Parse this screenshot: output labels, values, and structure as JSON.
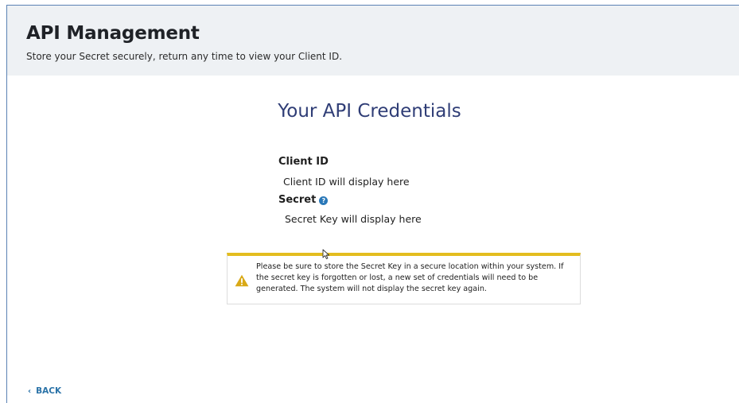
{
  "header": {
    "title": "API Management",
    "subtitle": "Store your Secret securely, return any time to view your Client ID."
  },
  "credentials": {
    "title": "Your API Credentials",
    "client_id": {
      "label": "Client ID",
      "value": "Client ID will display here"
    },
    "secret": {
      "label": "Secret",
      "help_icon": "question-circle-icon",
      "help_glyph": "?",
      "value": "Secret Key will display here"
    }
  },
  "alert": {
    "icon": "warning-triangle-icon",
    "message": "Please be sure to store the Secret Key in a secure location within your system. If the secret key is forgotten or lost, a new set of credentials will need to be generated. The system will not display the secret key again."
  },
  "footer": {
    "back_icon": "chevron-left-icon",
    "back_glyph": "‹",
    "back_label": "BACK"
  },
  "colors": {
    "header_bg": "#eef1f4",
    "title_color": "#2f3d76",
    "alert_accent": "#e3bd1f",
    "link_color": "#2b73a8",
    "help_icon_color": "#2a78b8"
  }
}
